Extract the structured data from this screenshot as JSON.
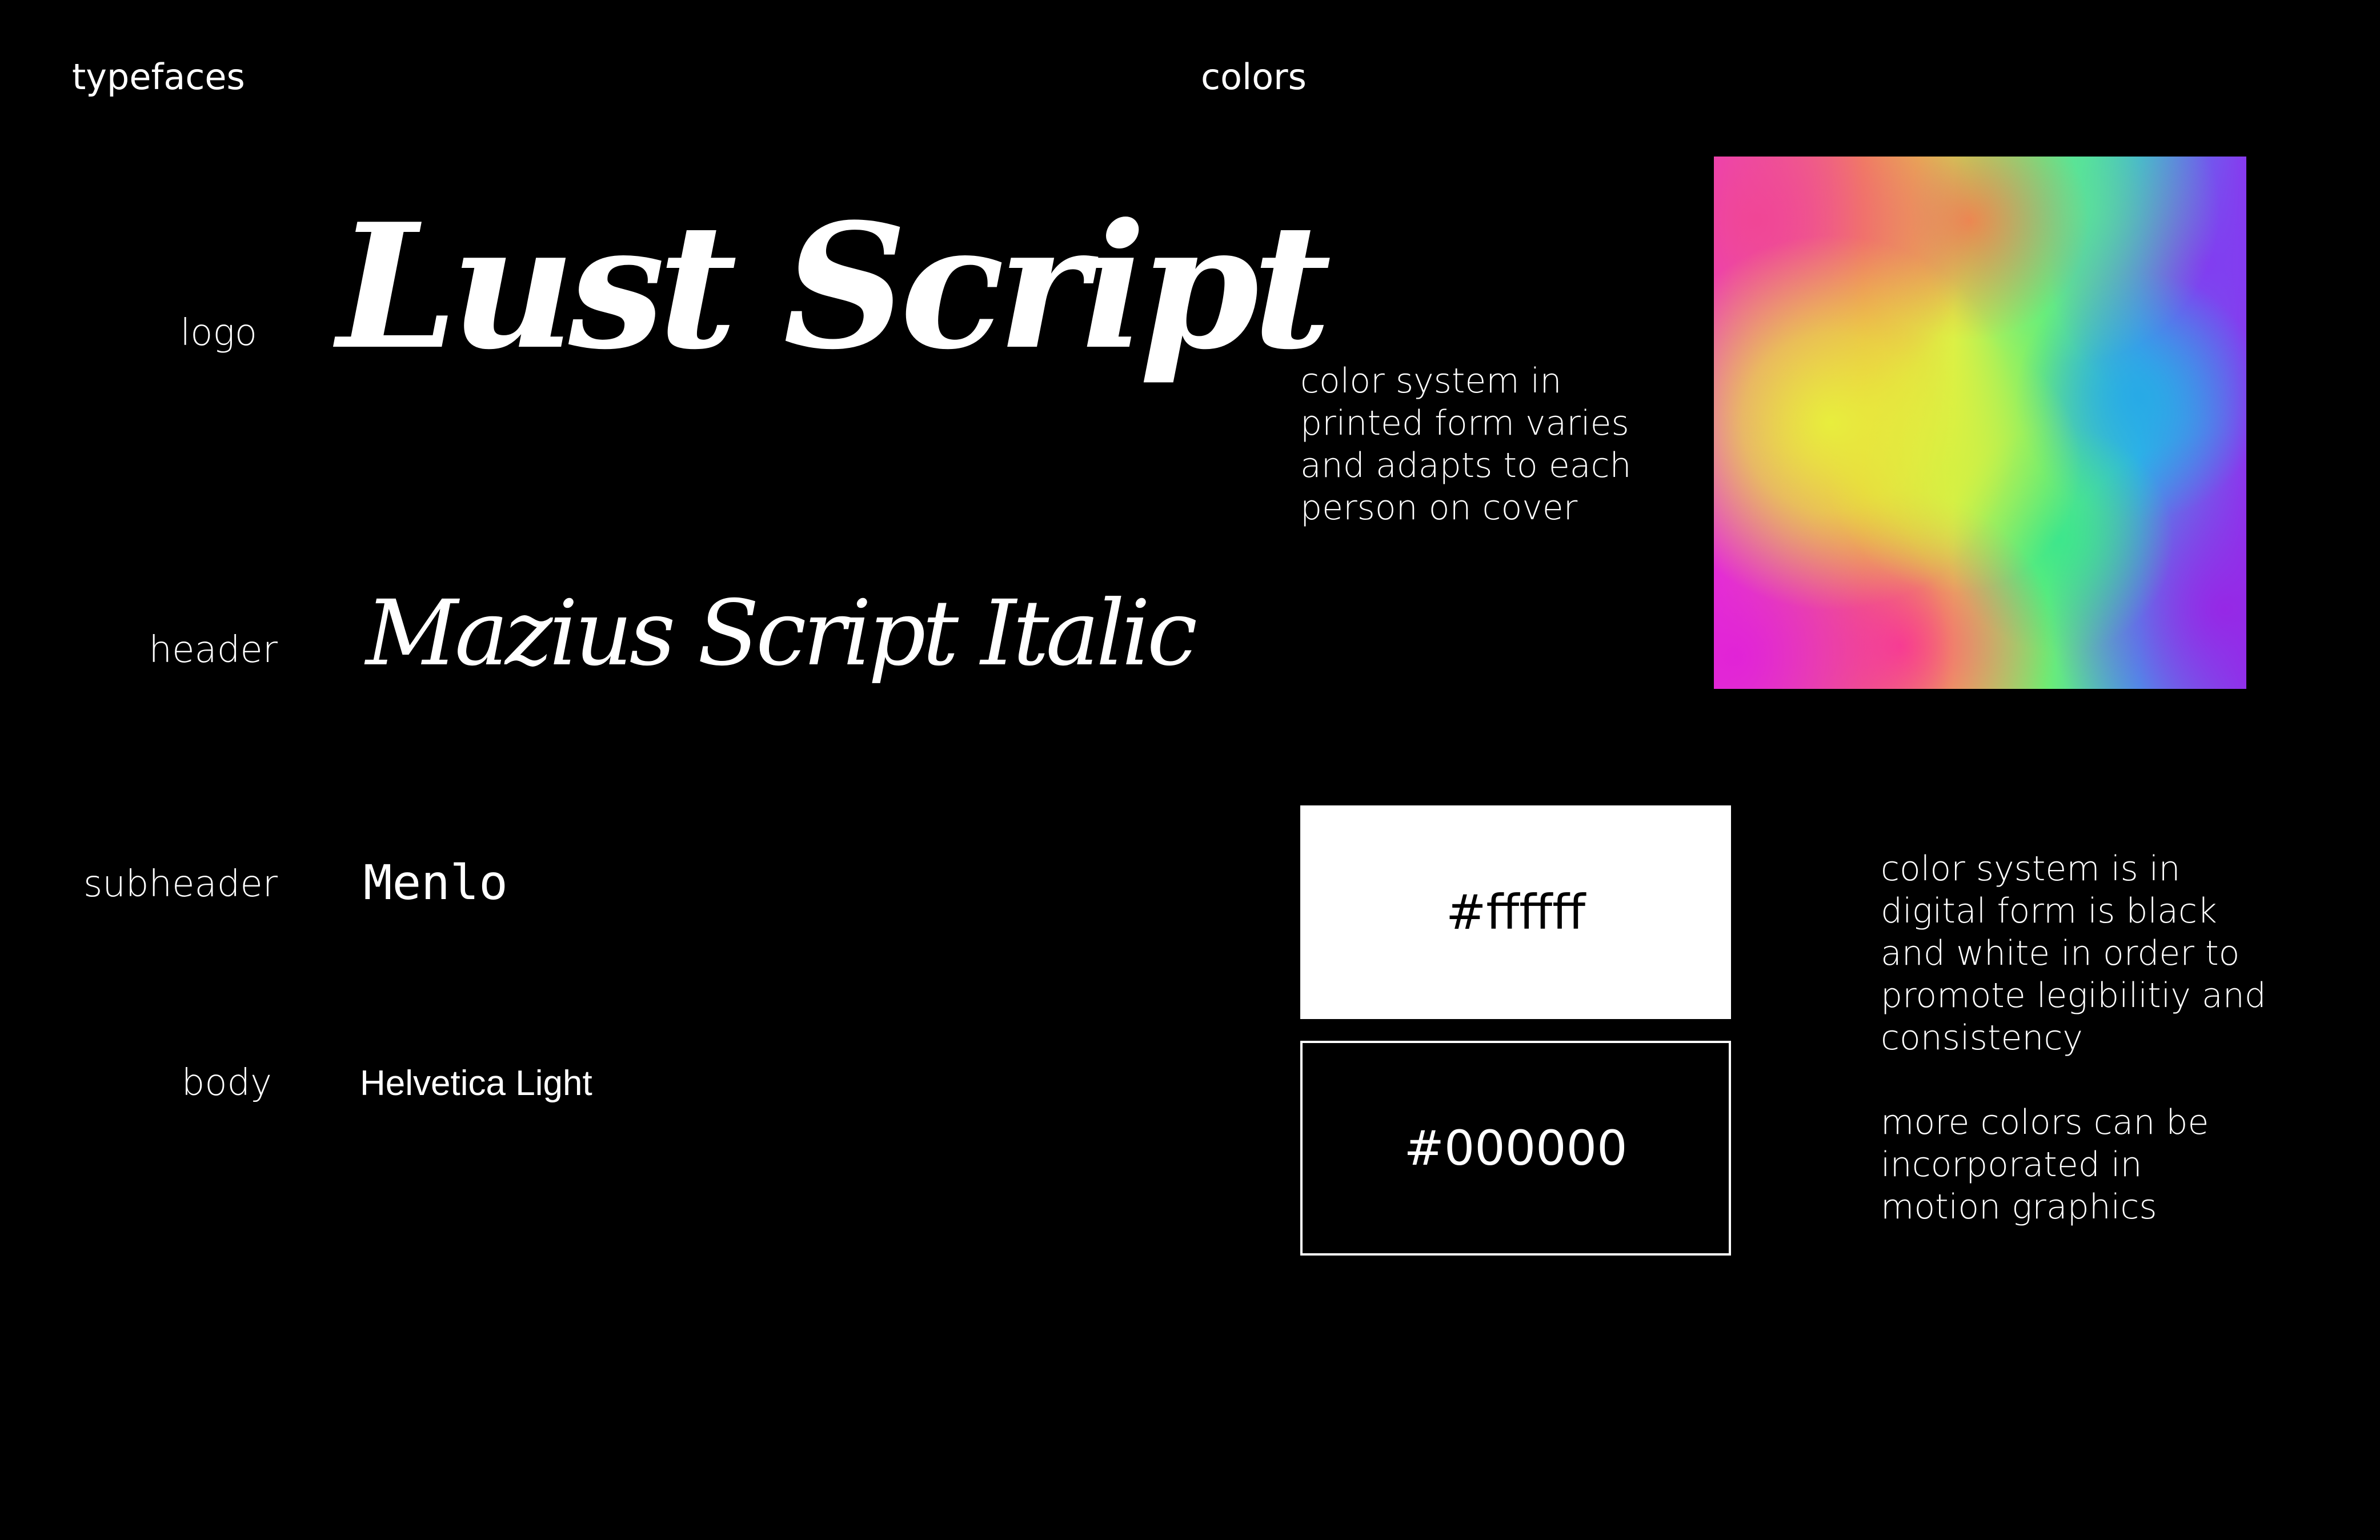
{
  "typefaces": {
    "title": "typefaces",
    "rows": [
      {
        "label": "logo",
        "sample": "Lust Script"
      },
      {
        "label": "header",
        "sample": "Mazius Script Italic"
      },
      {
        "label": "subheader",
        "sample": "Menlo"
      },
      {
        "label": "body",
        "sample": "Helvetica Light"
      }
    ]
  },
  "colors": {
    "title": "colors",
    "printed_description": "color system in printed form varies and adapts to each person on cover",
    "swatches": [
      {
        "label": "#ffffff",
        "hex": "#ffffff"
      },
      {
        "label": "#000000",
        "hex": "#000000"
      }
    ],
    "digital_description": "color system is in digital form is black and white in order to promote legibilitiy and consistency",
    "motion_note": "more colors can be incorporated in motion graphics"
  }
}
